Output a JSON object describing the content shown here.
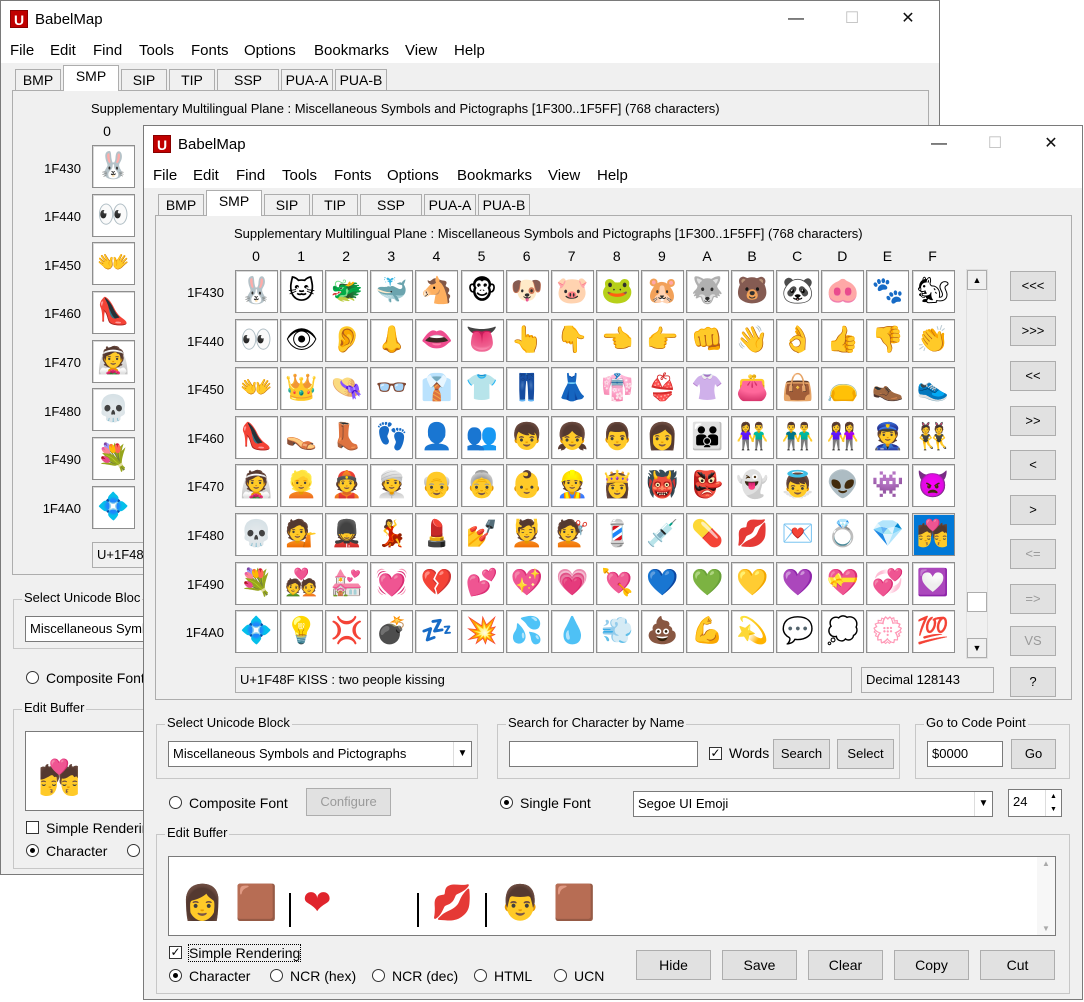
{
  "app": {
    "title": "BabelMap"
  },
  "menu": [
    "File",
    "Edit",
    "Find",
    "Tools",
    "Fonts",
    "Options",
    "Bookmarks",
    "View",
    "Help"
  ],
  "tabs": [
    "BMP",
    "SMP",
    "SIP",
    "TIP",
    "SSP",
    "PUA-A",
    "PUA-B"
  ],
  "active_tab": "SMP",
  "plane_label": "Supplementary Multilingual Plane : Miscellaneous Symbols and Pictographs [1F300..1F5FF] (768 characters)",
  "column_headers": [
    "0",
    "1",
    "2",
    "3",
    "4",
    "5",
    "6",
    "7",
    "8",
    "9",
    "A",
    "B",
    "C",
    "D",
    "E",
    "F"
  ],
  "row_headers": [
    "1F430",
    "1F440",
    "1F450",
    "1F460",
    "1F470",
    "1F480",
    "1F490",
    "1F4A0"
  ],
  "grid": [
    [
      "🐰",
      "🐱",
      "🐲",
      "🐳",
      "🐴",
      "🐵",
      "🐶",
      "🐷",
      "🐸",
      "🐹",
      "🐺",
      "🐻",
      "🐼",
      "🐽",
      "🐾",
      "🐿"
    ],
    [
      "👀",
      "👁",
      "👂",
      "👃",
      "👄",
      "👅",
      "👆",
      "👇",
      "👈",
      "👉",
      "👊",
      "👋",
      "👌",
      "👍",
      "👎",
      "👏"
    ],
    [
      "👐",
      "👑",
      "👒",
      "👓",
      "👔",
      "👕",
      "👖",
      "👗",
      "👘",
      "👙",
      "👚",
      "👛",
      "👜",
      "👝",
      "👞",
      "👟"
    ],
    [
      "👠",
      "👡",
      "👢",
      "👣",
      "👤",
      "👥",
      "👦",
      "👧",
      "👨",
      "👩",
      "👪",
      "👫",
      "👬",
      "👭",
      "👮",
      "👯"
    ],
    [
      "👰",
      "👱",
      "👲",
      "👳",
      "👴",
      "👵",
      "👶",
      "👷",
      "👸",
      "👹",
      "👺",
      "👻",
      "👼",
      "👽",
      "👾",
      "👿"
    ],
    [
      "💀",
      "💁",
      "💂",
      "💃",
      "💄",
      "💅",
      "💆",
      "💇",
      "💈",
      "💉",
      "💊",
      "💋",
      "💌",
      "💍",
      "💎",
      "💏"
    ],
    [
      "💐",
      "💑",
      "💒",
      "💓",
      "💔",
      "💕",
      "💖",
      "💗",
      "💘",
      "💙",
      "💚",
      "💛",
      "💜",
      "💝",
      "💞",
      "💟"
    ],
    [
      "💠",
      "💡",
      "💢",
      "💣",
      "💤",
      "💥",
      "💦",
      "💧",
      "💨",
      "💩",
      "💪",
      "💫",
      "💬",
      "💭",
      "💮",
      "💯"
    ]
  ],
  "char_info": "U+1F48F KISS : two people kissing",
  "decimal_info": "Decimal 128143",
  "nav_buttons": [
    "<<<",
    ">>>",
    "<<",
    ">>",
    "<",
    ">",
    "<=",
    "=>",
    "VS",
    "?"
  ],
  "select_block": {
    "label": "Select Unicode Block",
    "value": "Miscellaneous Symbols and Pictographs"
  },
  "search": {
    "label": "Search for Character by Name",
    "value": "",
    "words_label": "Words",
    "search_button": "Search",
    "select_button": "Select"
  },
  "goto": {
    "label": "Go to Code Point",
    "value": "$0000",
    "button": "Go"
  },
  "font": {
    "composite_label": "Composite Font",
    "configure_button": "Configure",
    "single_label": "Single Font",
    "font_name": "Segoe UI Emoji",
    "size": "24"
  },
  "edit_buffer": {
    "label": "Edit Buffer",
    "glyphs": [
      "👩",
      "🟫",
      "❤",
      "💋",
      "👨",
      "🟫"
    ],
    "simple_rendering": "Simple Rendering"
  },
  "output_formats": [
    "Character",
    "NCR (hex)",
    "NCR (dec)",
    "HTML",
    "UCN"
  ],
  "buffer_buttons": [
    "Hide",
    "Save",
    "Clear",
    "Copy",
    "Cut"
  ],
  "back_window": {
    "char_info_partial": "U+1F48",
    "select_block_partial": "Select Unicode Bloc",
    "block_value_partial": "Miscellaneous Symb",
    "composite_label": "Composite Font",
    "edit_buffer_label": "Edit Buffer",
    "buffer_glyph": "💏",
    "simple_rendering_partial": "Simple Renderin",
    "character_label": "Character"
  }
}
